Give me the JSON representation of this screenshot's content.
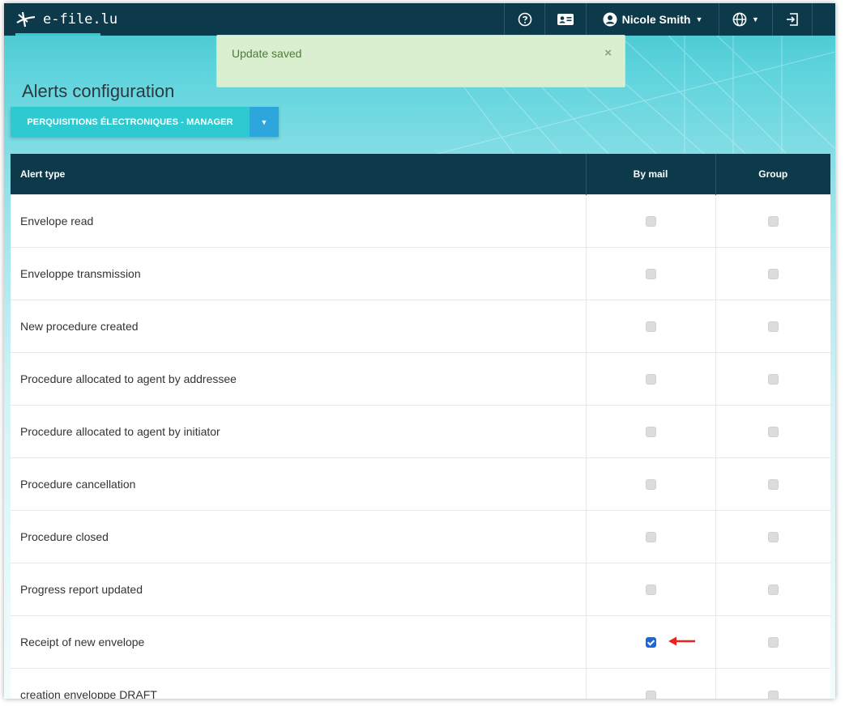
{
  "app": {
    "brand": "e-file.lu"
  },
  "navbar": {
    "help_icon": "question-circle-icon",
    "contact_icon": "contact-card-icon",
    "user_name": "Nicole Smith",
    "language_icon": "globe-icon",
    "logout_icon": "logout-icon"
  },
  "alert": {
    "message": "Update saved",
    "close": "×"
  },
  "page": {
    "title": "Alerts configuration"
  },
  "selector": {
    "value": "PERQUISITIONS ÉLECTRONIQUES - MANAGER"
  },
  "table": {
    "headers": [
      "Alert type",
      "By mail",
      "Group"
    ],
    "rows": [
      {
        "label": "Envelope read",
        "by_mail": false,
        "group": false
      },
      {
        "label": "Enveloppe transmission",
        "by_mail": false,
        "group": false
      },
      {
        "label": "New procedure created",
        "by_mail": false,
        "group": false
      },
      {
        "label": "Procedure allocated to agent by addressee",
        "by_mail": false,
        "group": false
      },
      {
        "label": "Procedure allocated to agent by initiator",
        "by_mail": false,
        "group": false
      },
      {
        "label": "Procedure cancellation",
        "by_mail": false,
        "group": false
      },
      {
        "label": "Procedure closed",
        "by_mail": false,
        "group": false
      },
      {
        "label": "Progress report updated",
        "by_mail": false,
        "group": false
      },
      {
        "label": "Receipt of new envelope",
        "by_mail": true,
        "group": false
      },
      {
        "label": "creation enveloppe DRAFT",
        "by_mail": false,
        "group": false
      }
    ]
  },
  "colors": {
    "navbar": "#0d3a4b",
    "accent": "#2ecad2",
    "checkbox_on": "#1d68d6",
    "annotation_arrow": "#e8231f"
  }
}
